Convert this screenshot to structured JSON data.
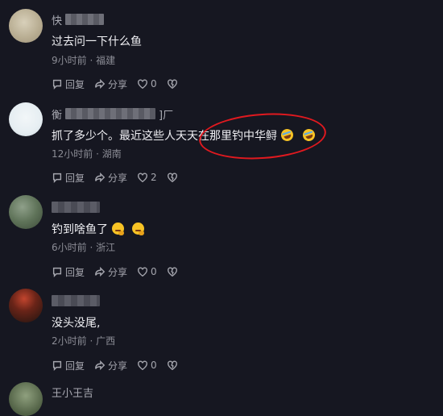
{
  "comments": [
    {
      "user_visible": "快",
      "text": "过去问一下什么鱼",
      "meta": "9小时前 · 福建",
      "reply": "回复",
      "share": "分享",
      "likes": "0"
    },
    {
      "user_visible": "衡",
      "user_suffix": "]厂",
      "text": "抓了多少个。最近这些人天天在那里钓中华鲟",
      "meta": "12小时前 · 湖南",
      "reply": "回复",
      "share": "分享",
      "likes": "2"
    },
    {
      "text": "钓到啥鱼了",
      "meta": "6小时前 · 浙江",
      "reply": "回复",
      "share": "分享",
      "likes": "0"
    },
    {
      "text": "没头没尾,",
      "meta": "2小时前 · 广西",
      "reply": "回复",
      "share": "分享",
      "likes": "0"
    },
    {
      "user_visible": "王小王吉"
    }
  ],
  "icons": [
    "reply-icon",
    "share-icon",
    "heart-icon",
    "dislike-icon"
  ],
  "colors": {
    "background": "#161721",
    "annotation": "#e0191f"
  }
}
